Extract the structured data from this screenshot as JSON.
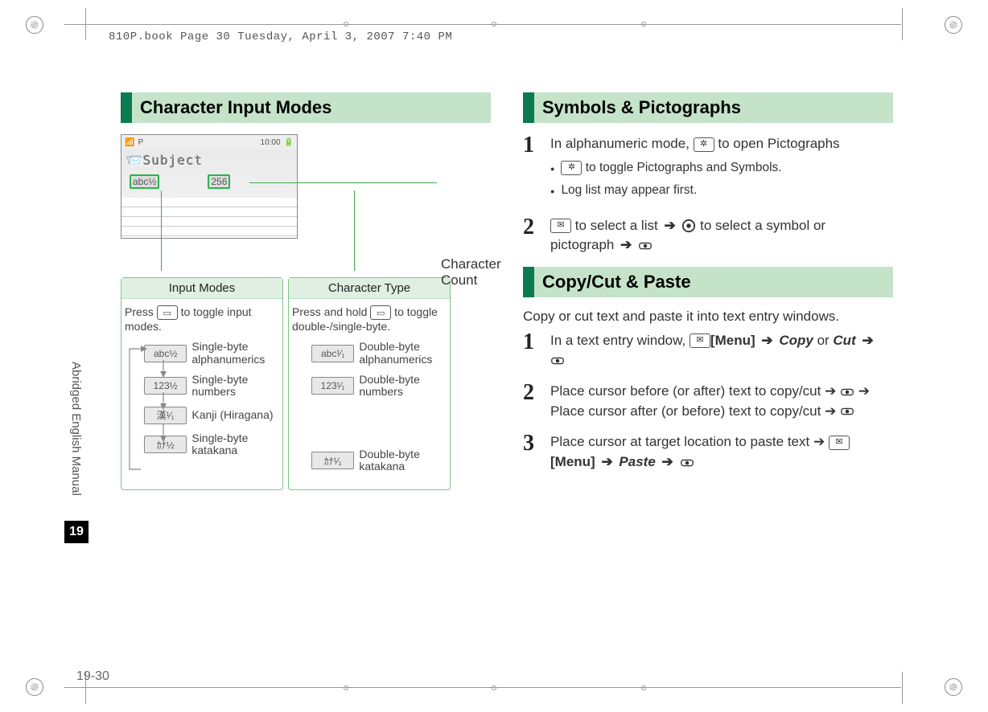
{
  "meta": {
    "header_text": "810P.book  Page 30  Tuesday, April 3, 2007  7:40 PM"
  },
  "sidebar": {
    "label": "Abridged English Manual",
    "chapter": "19",
    "page_num": "19-30"
  },
  "left": {
    "heading": "Character Input Modes",
    "char_count_label": "Character Count",
    "screen": {
      "subject": "Subject",
      "mode_indicator": "abc½",
      "count": "256",
      "time": "10:00"
    },
    "box_input": {
      "title": "Input Modes",
      "instruction_pre": "Press ",
      "instruction_post": " to toggle input modes.",
      "items": [
        {
          "pill": "abc½",
          "label": "Single-byte alphanumerics"
        },
        {
          "pill": "123½",
          "label": "Single-byte numbers"
        },
        {
          "pill": "漢¹⁄₁",
          "label": "Kanji (Hiragana)"
        },
        {
          "pill": "ｶﾅ½",
          "label": "Single-byte katakana"
        }
      ]
    },
    "box_chartype": {
      "title": "Character Type",
      "instruction_pre": "Press and hold ",
      "instruction_post": " to toggle double-/single-byte.",
      "items": [
        {
          "pill": "abc¹⁄₁",
          "label": "Double-byte alphanumerics"
        },
        {
          "pill": "123¹⁄₁",
          "label": "Double-byte numbers"
        },
        {
          "pill": "ｶﾅ¹⁄₁",
          "label": "Double-byte katakana"
        }
      ]
    }
  },
  "right": {
    "sec1_heading": "Symbols & Pictographs",
    "step1": {
      "text_pre": "In alphanumeric mode, ",
      "text_post": " to open Pictographs",
      "bullet_a_post": " to toggle Pictographs and Symbols.",
      "bullet_b": "Log list may appear first."
    },
    "step2": {
      "text_a": " to select a list ",
      "text_b": " to select a symbol or pictograph "
    },
    "sec2_heading": "Copy/Cut & Paste",
    "sec2_intro": "Copy or cut text and paste it into text entry windows.",
    "cstep1": {
      "a": "In a text entry window, ",
      "menu": "[Menu]",
      "arrow": " ➔ ",
      "copy": "Copy",
      "or": "  or ",
      "cut": "Cut",
      "arrow2": " ➔ "
    },
    "cstep2": {
      "a": "Place cursor before (or after) text to copy/cut ➔ ",
      "b": " ➔ Place cursor after (or before) text to copy/cut ➔ "
    },
    "cstep3": {
      "a": "Place cursor at target location to paste text ➔ ",
      "menu": "[Menu]",
      "arrow": " ➔ ",
      "paste": "Paste",
      "arrow2": " ➔ "
    }
  }
}
